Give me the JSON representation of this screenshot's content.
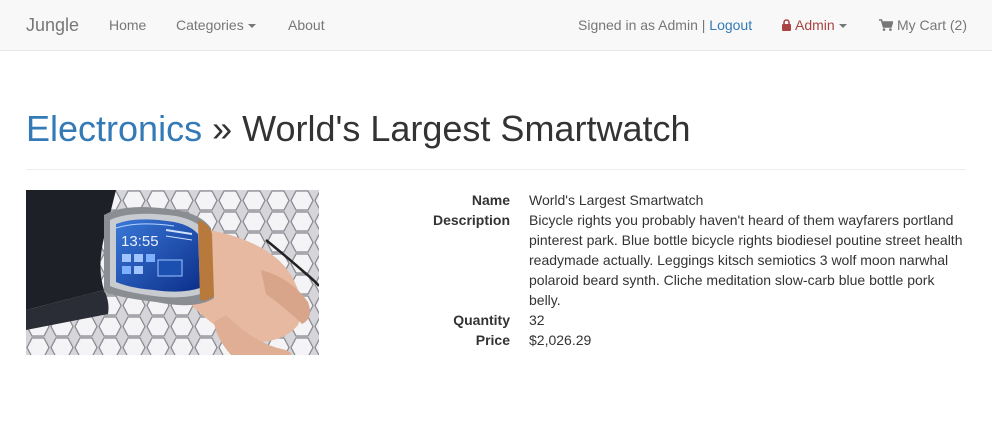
{
  "navbar": {
    "brand": "Jungle",
    "home": "Home",
    "categories": "Categories",
    "about": "About",
    "signed_in": "Signed in as Admin |",
    "logout": "Logout",
    "admin": "Admin",
    "cart": "My Cart (2)",
    "icons": {
      "admin": "lock-icon",
      "cart": "shopping-cart-icon"
    },
    "colors": {
      "admin": "#a94442",
      "link": "#337ab7"
    }
  },
  "header": {
    "category": "Electronics",
    "separator": "»",
    "title": "World's Largest Smartwatch"
  },
  "product": {
    "fields": [
      {
        "label": "Name",
        "value": "World's Largest Smartwatch"
      },
      {
        "label": "Description",
        "value": "Bicycle rights you probably haven't heard of them wayfarers portland pinterest park. Blue bottle bicycle rights biodiesel poutine street health readymade actually. Leggings kitsch semiotics 3 wolf moon narwhal polaroid beard synth. Cliche meditation slow-carb blue bottle pork belly."
      },
      {
        "label": "Quantity",
        "value": "32"
      },
      {
        "label": "Price",
        "value": "$2,026.29"
      }
    ],
    "image_clock": "13:55"
  }
}
